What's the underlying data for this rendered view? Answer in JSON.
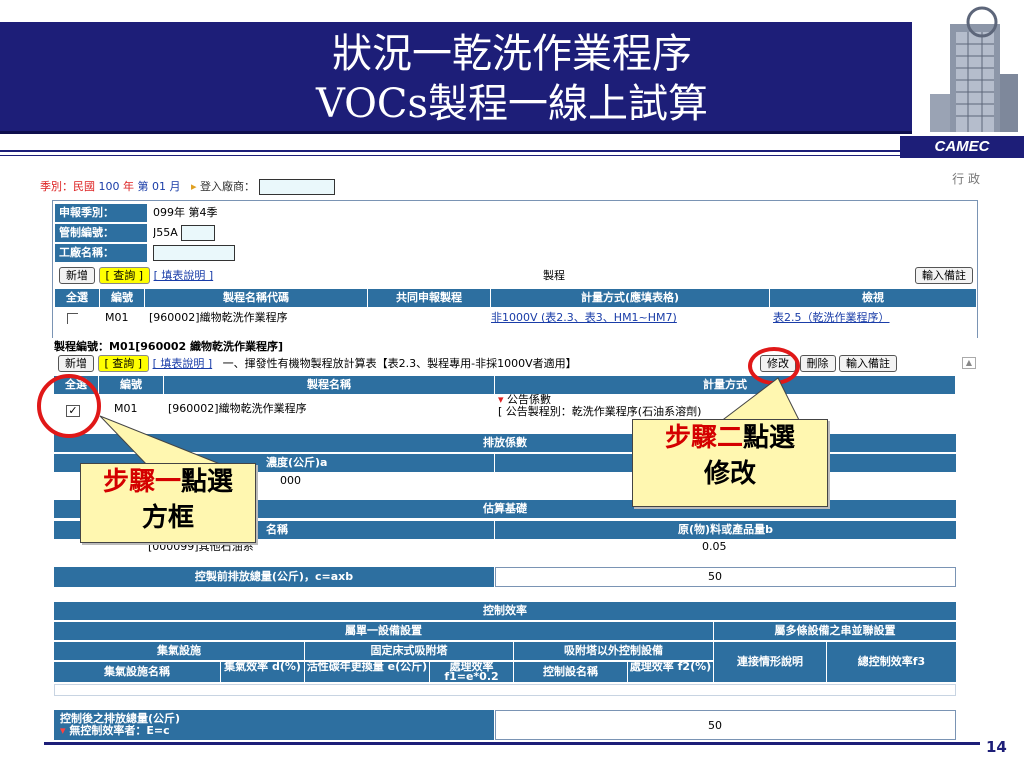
{
  "slide": {
    "title_line1": "狀況一乾洗作業程序",
    "title_line2": "VOCs製程一線上試算",
    "logo_text": "CAMEC",
    "page_number": "14"
  },
  "top_bar": {
    "season_label": "季別：民國",
    "year": "100",
    "year_unit": "年",
    "season": "第 01 月",
    "vendor_label": "登入廠商：",
    "corner_text": "行 政"
  },
  "info": {
    "report_season_label": "申報季別：",
    "report_season_value": "099年 第4季",
    "control_no_label": "管制編號：",
    "control_no_value": "J55A",
    "factory_label": "工廠名稱："
  },
  "toolbar1": {
    "new_label": "新增",
    "query_label": "[ 查詢 ]",
    "guide_label": "[ 填表說明 ]",
    "center_label": "製程",
    "remark_label": "輸入備註"
  },
  "table1": {
    "headers": [
      "全選",
      "編號",
      "製程名稱代碼",
      "共同申報製程",
      "計量方式(應填表格)",
      "檢視"
    ],
    "row": {
      "id": "M01",
      "name": "[960002]織物乾洗作業程序",
      "method_link": "非1000V (表2.3、表3、HM1~HM7)",
      "view_link": "表2.5（乾洗作業程序）"
    }
  },
  "section2": {
    "process_no": "製程編號：M01[960002 織物乾洗作業程序]",
    "new_label": "新增",
    "query_label": "[ 查詢 ]",
    "guide_label": "[ 填表說明 ]",
    "title": "一、揮發性有機物製程放計算表【表2.3、製程專用-非採1000V者適用】",
    "modify_label": "修改",
    "delete_label": "刪除",
    "remark_label": "輸入備註",
    "headers": [
      "全選",
      "編號",
      "製程名稱",
      "計量方式"
    ],
    "row": {
      "id": "M01",
      "name": "[960002]織物乾洗作業程序",
      "method_note": "公告係數",
      "method_detail": "[ 公告製程別：乾洗作業程序(石油系溶劑)"
    }
  },
  "emission": {
    "header": "排放係數",
    "col1": "濃度(公斤)a",
    "value1": "000"
  },
  "estimate": {
    "header": "估算基礎",
    "col1": "名稱",
    "col2": "原(物)料或產品量b",
    "row_name": "[000099]其他石油系",
    "row_value": "0.05"
  },
  "pre_control": {
    "label": "控製前排放總量(公斤)，c=axb",
    "value": "50"
  },
  "efficiency": {
    "header": "控制效率",
    "single_header": "屬單一設備設置",
    "multi_header": "屬多條設備之串並聯設置",
    "collect_header": "集氣設施",
    "fixed_bed_header": "固定床式吸附塔",
    "other_header": "吸附塔以外控制設備",
    "col_collect_name": "集氣設施名稱",
    "col_collect_eff": "集氣效率 d(%)",
    "col_carbon": "活性碳年更換量 e(公斤)",
    "col_eff1": "處理效率 f1=e*0.2",
    "col_ctrl_name": "控制設名稱",
    "col_eff2": "處理效率 f2(%)",
    "col_connect": "連接情形說明",
    "col_total": "總控制效率f3"
  },
  "post_control": {
    "label": "控制後之排放總量(公斤)",
    "note": "無控制效率者：E=c",
    "value": "50"
  },
  "callouts": {
    "step1_red": "步驟一",
    "step1_black": "點選",
    "step1_line2": "方框",
    "step2_red": "步驟二",
    "step2_black": "點選",
    "step2_line2": "修改"
  }
}
